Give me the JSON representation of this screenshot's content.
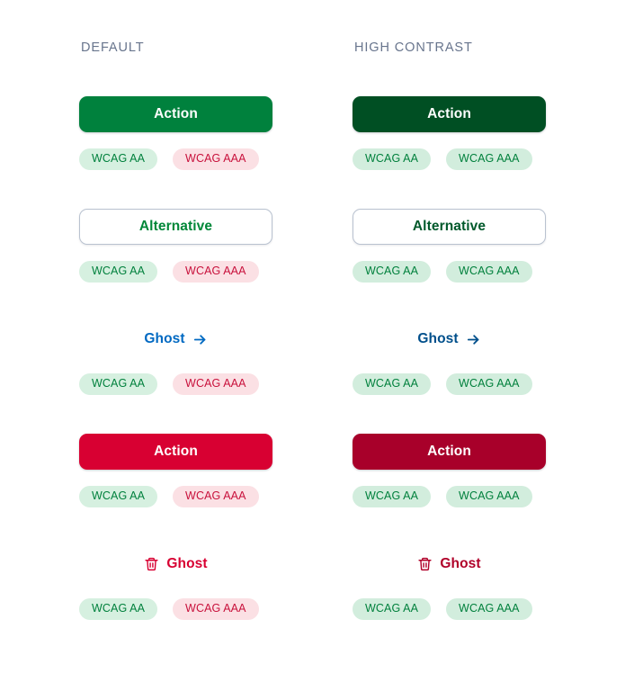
{
  "columns": [
    {
      "header": "DEFAULT",
      "variants": [
        {
          "style": "filled",
          "label": "Action",
          "bg": "#00813D",
          "fg": "#FFFFFF",
          "icon": null,
          "badges": [
            {
              "label": "WCAG AA",
              "state": "pass"
            },
            {
              "label": "WCAG AAA",
              "state": "fail"
            }
          ]
        },
        {
          "style": "outline",
          "label": "Alternative",
          "bg": "#FFFFFF",
          "fg": "#008738",
          "border": "#B9C2D0",
          "icon": null,
          "badges": [
            {
              "label": "WCAG AA",
              "state": "pass"
            },
            {
              "label": "WCAG AAA",
              "state": "fail"
            }
          ]
        },
        {
          "style": "ghost",
          "label": "Ghost",
          "bg": "transparent",
          "fg": "#0069C2",
          "icon": "arrow-right-icon",
          "icon_position": "after",
          "badges": [
            {
              "label": "WCAG AA",
              "state": "pass"
            },
            {
              "label": "WCAG AAA",
              "state": "fail"
            }
          ]
        },
        {
          "style": "filled",
          "label": "Action",
          "bg": "#D80032",
          "fg": "#FFFFFF",
          "icon": null,
          "badges": [
            {
              "label": "WCAG AA",
              "state": "pass"
            },
            {
              "label": "WCAG AAA",
              "state": "fail"
            }
          ]
        },
        {
          "style": "ghost",
          "label": "Ghost",
          "bg": "transparent",
          "fg": "#D80032",
          "icon": "trash-icon",
          "icon_position": "before",
          "badges": [
            {
              "label": "WCAG AA",
              "state": "pass"
            },
            {
              "label": "WCAG AAA",
              "state": "fail"
            }
          ]
        }
      ]
    },
    {
      "header": "HIGH CONTRAST",
      "variants": [
        {
          "style": "filled",
          "label": "Action",
          "bg": "#004F23",
          "fg": "#FFFFFF",
          "icon": null,
          "badges": [
            {
              "label": "WCAG AA",
              "state": "pass"
            },
            {
              "label": "WCAG AAA",
              "state": "pass"
            }
          ]
        },
        {
          "style": "outline",
          "label": "Alternative",
          "bg": "#FFFFFF",
          "fg": "#00592B",
          "border": "#B9C2D0",
          "icon": null,
          "badges": [
            {
              "label": "WCAG AA",
              "state": "pass"
            },
            {
              "label": "WCAG AAA",
              "state": "pass"
            }
          ]
        },
        {
          "style": "ghost",
          "label": "Ghost",
          "bg": "transparent",
          "fg": "#004F8B",
          "icon": "arrow-right-icon",
          "icon_position": "after",
          "badges": [
            {
              "label": "WCAG AA",
              "state": "pass"
            },
            {
              "label": "WCAG AAA",
              "state": "pass"
            }
          ]
        },
        {
          "style": "filled",
          "label": "Action",
          "bg": "#A8002A",
          "fg": "#FFFFFF",
          "icon": null,
          "badges": [
            {
              "label": "WCAG AA",
              "state": "pass"
            },
            {
              "label": "WCAG AAA",
              "state": "pass"
            }
          ]
        },
        {
          "style": "ghost",
          "label": "Ghost",
          "bg": "transparent",
          "fg": "#B00029",
          "icon": "trash-icon",
          "icon_position": "before",
          "badges": [
            {
              "label": "WCAG AA",
              "state": "pass"
            },
            {
              "label": "WCAG AAA",
              "state": "pass"
            }
          ]
        }
      ]
    }
  ],
  "palette": {
    "background": "#FFFFFF",
    "header_text": "#68758D",
    "badge_pass_bg": "#D6F0E0",
    "badge_pass_fg": "#00803C",
    "badge_fail_bg": "#FBE0E4",
    "badge_fail_fg": "#C8103B",
    "outline_border": "#B9C2D0"
  }
}
